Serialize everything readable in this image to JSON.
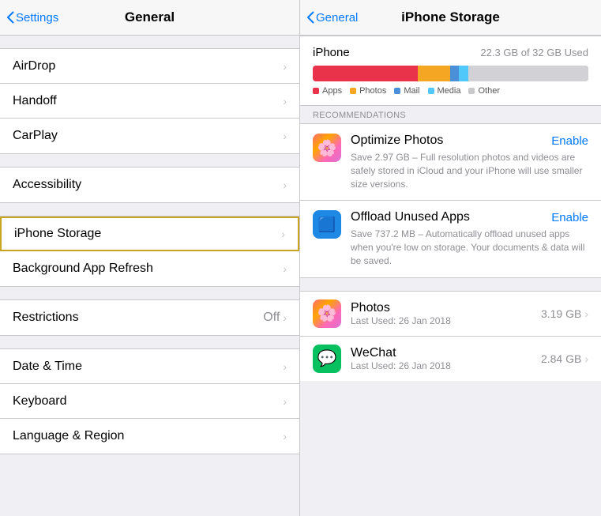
{
  "left": {
    "back_label": "Settings",
    "title": "General",
    "groups": [
      {
        "items": [
          {
            "id": "airdrop",
            "label": "AirDrop",
            "value": "",
            "chevron": true
          },
          {
            "id": "handoff",
            "label": "Handoff",
            "value": "",
            "chevron": true
          },
          {
            "id": "carplay",
            "label": "CarPlay",
            "value": "",
            "chevron": true
          }
        ]
      },
      {
        "items": [
          {
            "id": "accessibility",
            "label": "Accessibility",
            "value": "",
            "chevron": true
          }
        ]
      },
      {
        "items": [
          {
            "id": "iphone-storage",
            "label": "iPhone Storage",
            "value": "",
            "chevron": true,
            "selected": true
          },
          {
            "id": "background-app-refresh",
            "label": "Background App Refresh",
            "value": "",
            "chevron": true
          }
        ]
      },
      {
        "items": [
          {
            "id": "restrictions",
            "label": "Restrictions",
            "value": "Off",
            "chevron": true
          }
        ]
      },
      {
        "items": [
          {
            "id": "date-time",
            "label": "Date & Time",
            "value": "",
            "chevron": true
          },
          {
            "id": "keyboard",
            "label": "Keyboard",
            "value": "",
            "chevron": true
          },
          {
            "id": "language-region",
            "label": "Language & Region",
            "value": "",
            "chevron": true
          }
        ]
      }
    ]
  },
  "right": {
    "back_label": "General",
    "title": "iPhone Storage",
    "storage": {
      "device": "iPhone",
      "usage_text": "22.3 GB of 32 GB Used",
      "bar_segments": [
        {
          "id": "apps",
          "color": "#e8334a",
          "width": 38
        },
        {
          "id": "photos",
          "color": "#f5a623",
          "width": 12
        },
        {
          "id": "mail",
          "color": "#4a90d9",
          "width": 4
        },
        {
          "id": "media",
          "color": "#50c8fa",
          "width": 8
        },
        {
          "id": "other",
          "color": "#c7c7cc",
          "width": 8
        }
      ],
      "legend": [
        {
          "id": "apps",
          "label": "Apps",
          "color": "#e8334a"
        },
        {
          "id": "photos",
          "label": "Photos",
          "color": "#f5a623"
        },
        {
          "id": "mail",
          "label": "Mail",
          "color": "#4a90d9"
        },
        {
          "id": "media",
          "label": "Media",
          "color": "#50c8fa"
        },
        {
          "id": "other",
          "label": "Other",
          "color": "#c7c7cc"
        }
      ]
    },
    "recommendations_label": "Recommendations",
    "recommendations": [
      {
        "id": "optimize-photos",
        "icon": "🌸",
        "icon_bg": "#fff",
        "title": "Optimize Photos",
        "enable_label": "Enable",
        "description": "Save 2.97 GB – Full resolution photos and videos are safely stored in iCloud and your iPhone will use smaller size versions."
      },
      {
        "id": "offload-apps",
        "icon": "🟦",
        "icon_bg": "#1e88e5",
        "title": "Offload Unused Apps",
        "enable_label": "Enable",
        "description": "Save 737.2 MB – Automatically offload unused apps when you're low on storage. Your documents & data will be saved."
      }
    ],
    "apps": [
      {
        "id": "photos-app",
        "icon": "🌸",
        "name": "Photos",
        "last_used": "Last Used: 26 Jan 2018",
        "size": "3.19 GB"
      },
      {
        "id": "wechat-app",
        "icon": "💬",
        "name": "WeChat",
        "last_used": "Last Used: 26 Jan 2018",
        "size": "2.84 GB"
      }
    ]
  }
}
